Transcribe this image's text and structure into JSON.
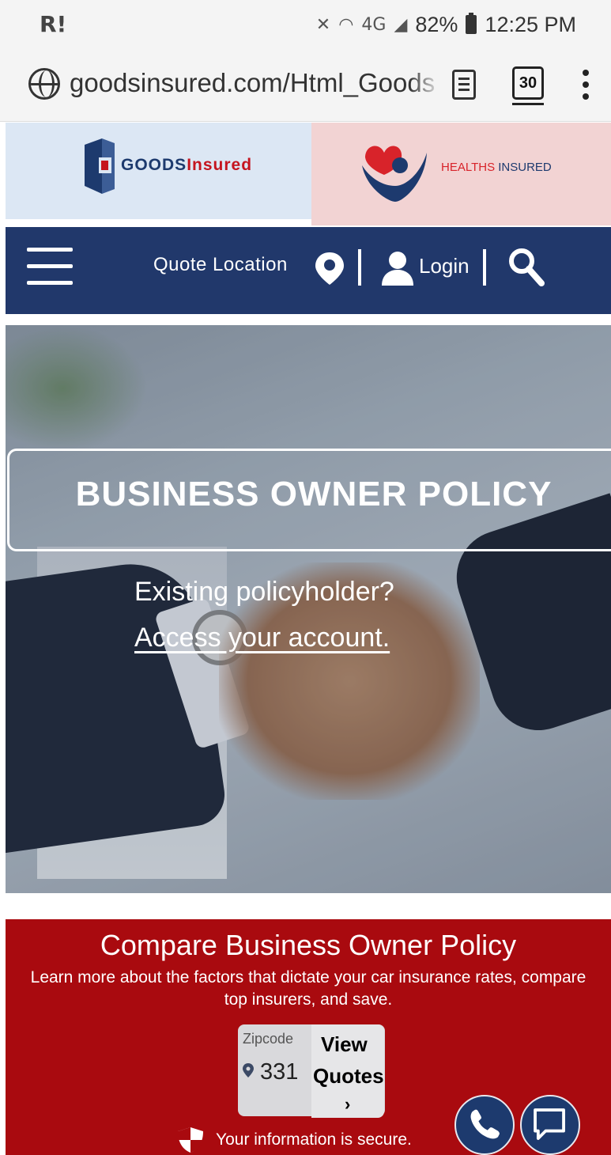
{
  "status_bar": {
    "time": "12:25 PM",
    "battery": "82%",
    "network": "4G"
  },
  "browser": {
    "url": "goodsinsured.com/Html_Goods",
    "tab_count": "30"
  },
  "brands": {
    "goods": {
      "name_part1": "GOODS",
      "name_part2": "Insured"
    },
    "healths": {
      "name_part1": "HEALTHS",
      "name_part2": " INSURED"
    }
  },
  "nav": {
    "quote_location": "Quote Location",
    "login": "Login"
  },
  "hero": {
    "title": "BUSINESS OWNER POLICY",
    "existing": "Existing policyholder?",
    "access_link": "Access your account."
  },
  "compare": {
    "title": "Compare Business Owner Policy",
    "subtitle": "Learn more about the factors that dictate your car insurance rates, compare top insurers, and save.",
    "zip_label": "Zipcode",
    "zip_value": "331",
    "button_line1": "View",
    "button_line2": "Quotes",
    "button_chevron": "›",
    "secure_text": "Your information is secure."
  },
  "colors": {
    "navy": "#21386b",
    "red": "#a90a0f",
    "brand_red": "#c5141f"
  }
}
